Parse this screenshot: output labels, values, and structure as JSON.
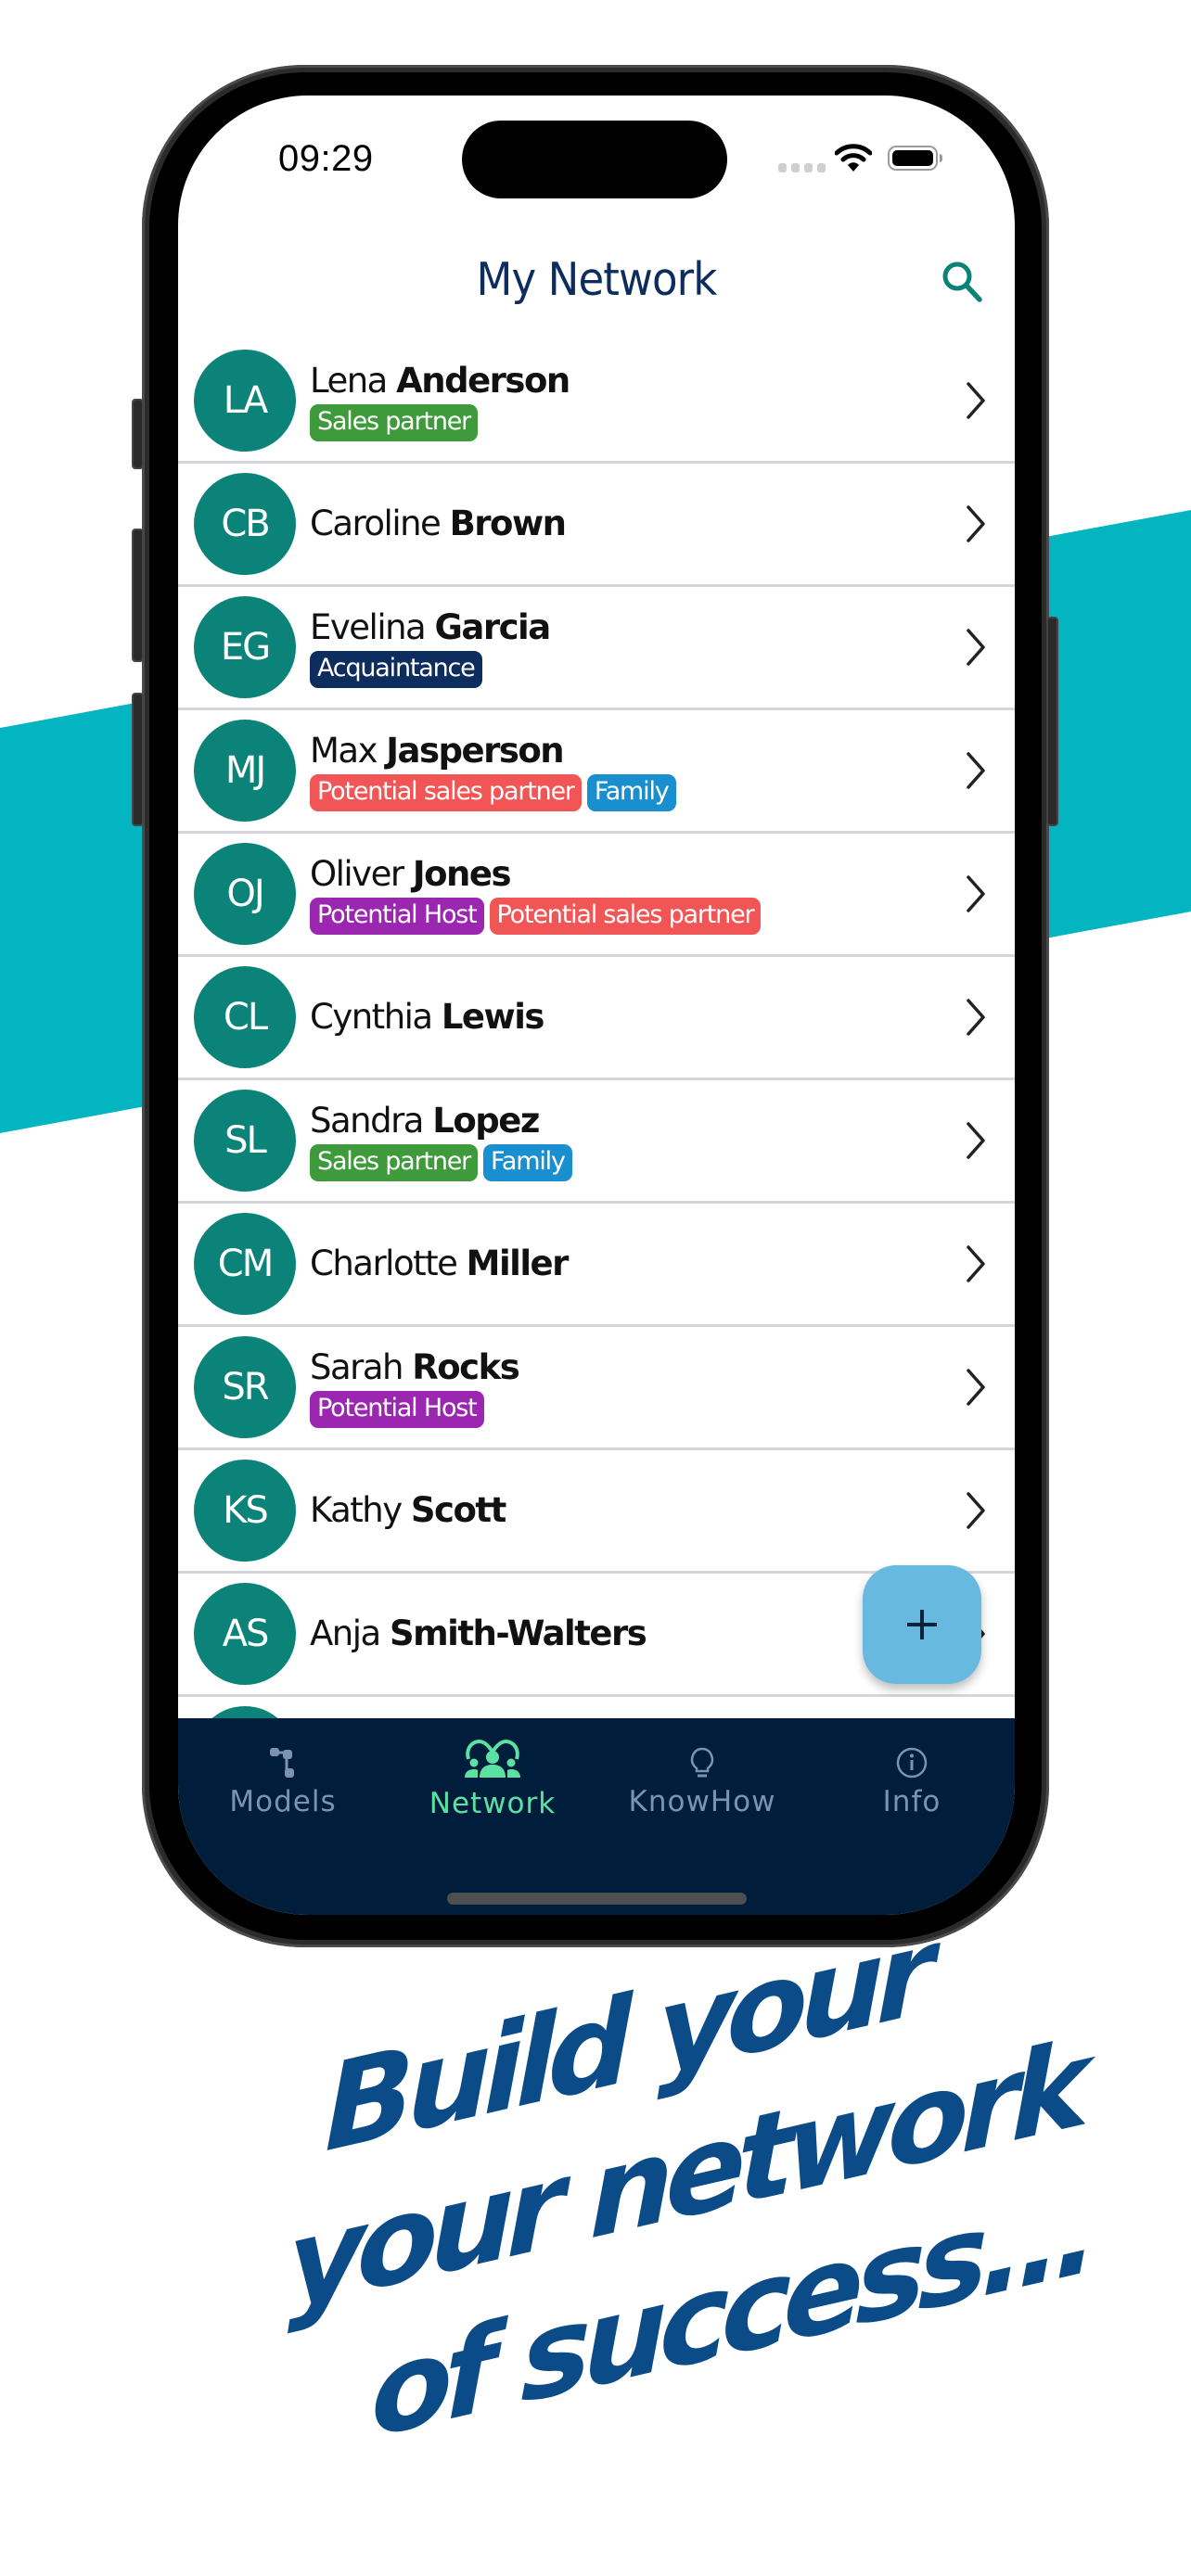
{
  "colors": {
    "band": "#02b5c0",
    "avatar": "#0b8378",
    "title": "#0c2d5e",
    "accent_search": "#0b8378",
    "tabbar_bg": "#001d3b",
    "tab_active": "#5be2a3",
    "tab_inactive": "#7b93b0",
    "fab": "#67b9e0",
    "tagline": "#0b4b88"
  },
  "status_bar": {
    "time": "09:29"
  },
  "header": {
    "title": "My Network",
    "search_icon": "search-icon"
  },
  "tag_colors": {
    "Sales partner": "#3f9a3c",
    "Acquaintance": "#0c2d5e",
    "Potential sales partner": "#f25555",
    "Family": "#1a8fd0",
    "Potential Host": "#9b27b0"
  },
  "contacts": [
    {
      "initials": "LA",
      "first": "Lena",
      "last": "Anderson",
      "tags": [
        "Sales partner"
      ]
    },
    {
      "initials": "CB",
      "first": "Caroline",
      "last": "Brown",
      "tags": []
    },
    {
      "initials": "EG",
      "first": "Evelina",
      "last": "Garcia",
      "tags": [
        "Acquaintance"
      ]
    },
    {
      "initials": "MJ",
      "first": "Max",
      "last": "Jasperson",
      "tags": [
        "Potential sales partner",
        "Family"
      ]
    },
    {
      "initials": "OJ",
      "first": "Oliver",
      "last": "Jones",
      "tags": [
        "Potential Host",
        "Potential sales partner"
      ]
    },
    {
      "initials": "CL",
      "first": "Cynthia",
      "last": "Lewis",
      "tags": []
    },
    {
      "initials": "SL",
      "first": "Sandra",
      "last": "Lopez",
      "tags": [
        "Sales partner",
        "Family"
      ]
    },
    {
      "initials": "CM",
      "first": "Charlotte",
      "last": "Miller",
      "tags": []
    },
    {
      "initials": "SR",
      "first": "Sarah",
      "last": "Rocks",
      "tags": [
        "Potential Host"
      ]
    },
    {
      "initials": "KS",
      "first": "Kathy",
      "last": "Scott",
      "tags": []
    },
    {
      "initials": "AS",
      "first": "Anja",
      "last": "Smith-Walters",
      "tags": []
    },
    {
      "initials": "",
      "first": "",
      "last": "",
      "tags": []
    }
  ],
  "fab": {
    "label": "+",
    "icon": "plus-icon"
  },
  "tabs": [
    {
      "label": "Models",
      "icon": "models-icon",
      "active": false
    },
    {
      "label": "Network",
      "icon": "network-icon",
      "active": true
    },
    {
      "label": "KnowHow",
      "icon": "lightbulb-icon",
      "active": false
    },
    {
      "label": "Info",
      "icon": "info-icon",
      "active": false
    }
  ],
  "tagline": {
    "lines": [
      "Build your",
      "your network",
      "of success..."
    ]
  }
}
